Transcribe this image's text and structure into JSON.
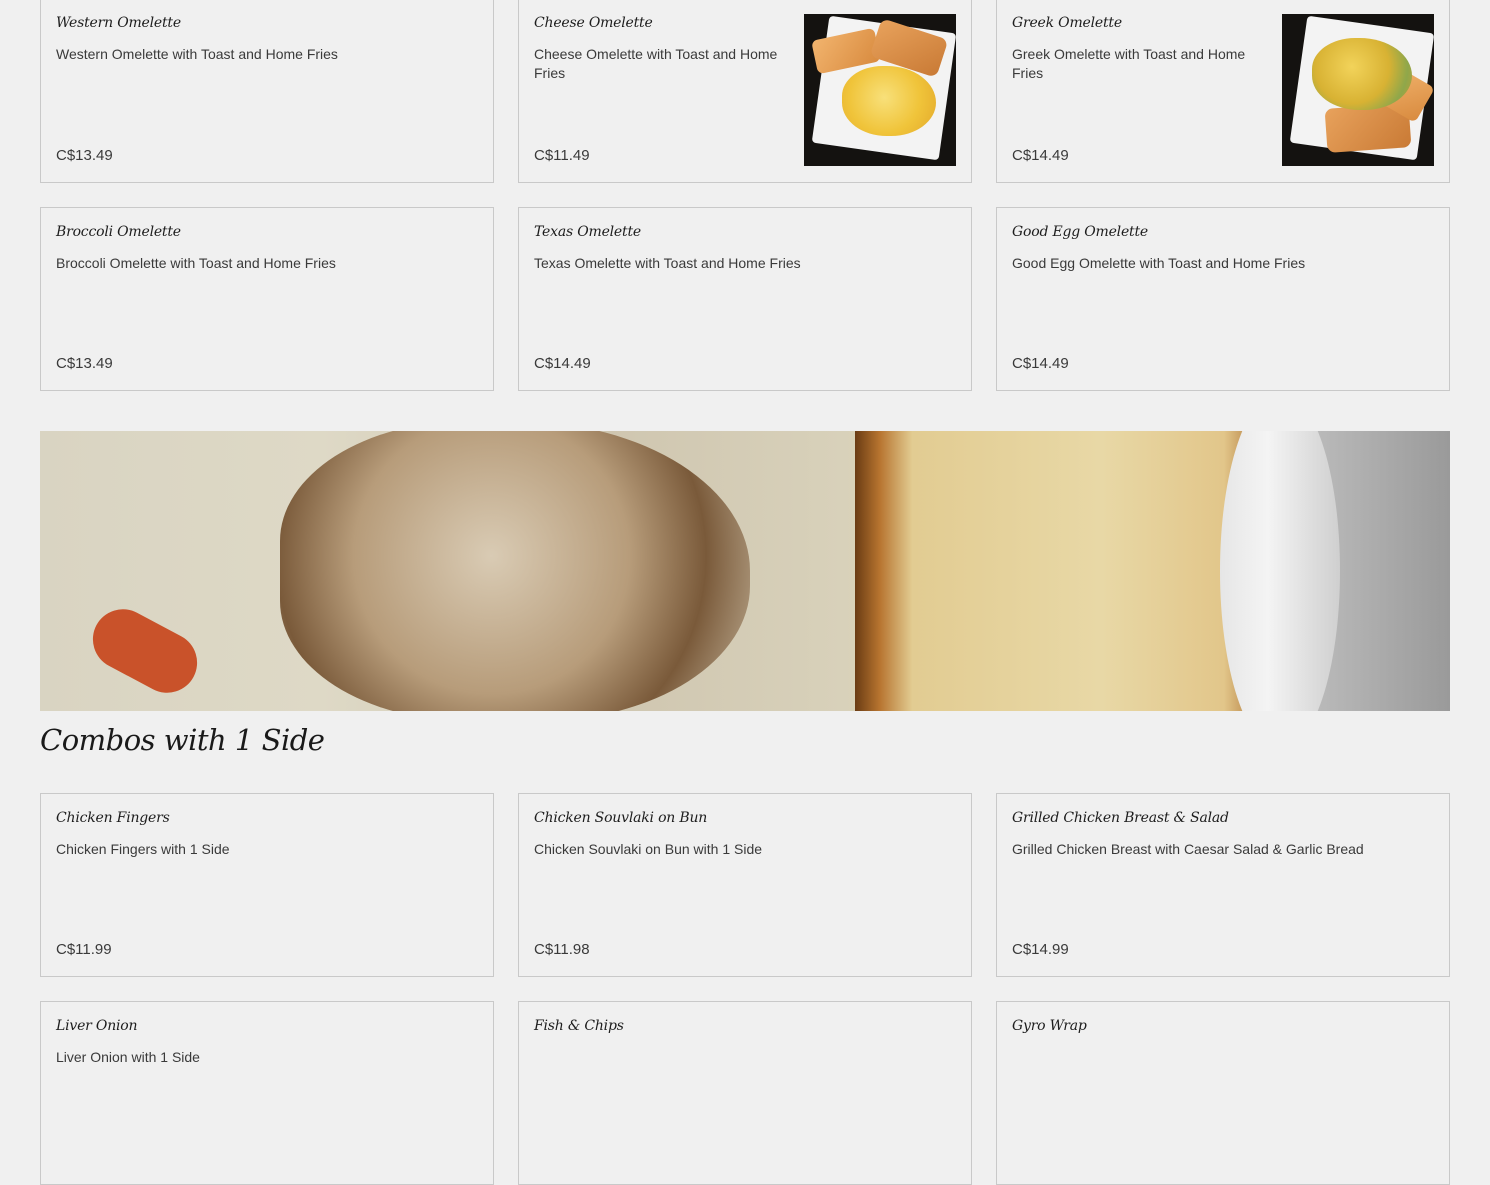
{
  "omelettes_row1": [
    {
      "name": "Western Omelette",
      "description": "Western Omelette with Toast and Home Fries",
      "price": "C$13.49",
      "has_image": false
    },
    {
      "name": "Cheese Omelette",
      "description": "Cheese Omelette with Toast and Home Fries",
      "price": "C$11.49",
      "has_image": true
    },
    {
      "name": "Greek Omelette",
      "description": "Greek Omelette with Toast and Home Fries",
      "price": "C$14.49",
      "has_image": true
    }
  ],
  "omelettes_row2": [
    {
      "name": "Broccoli Omelette",
      "description": "Broccoli Omelette with Toast and Home Fries",
      "price": "C$13.49"
    },
    {
      "name": "Texas Omelette",
      "description": "Texas Omelette with Toast and Home Fries",
      "price": "C$14.49"
    },
    {
      "name": "Good Egg Omelette",
      "description": "Good Egg Omelette with Toast and Home Fries",
      "price": "C$14.49"
    }
  ],
  "combos_section": {
    "title": "Combos with 1 Side"
  },
  "combos_row1": [
    {
      "name": "Chicken Fingers",
      "description": "Chicken Fingers with 1 Side",
      "price": "C$11.99"
    },
    {
      "name": "Chicken Souvlaki on Bun",
      "description": "Chicken Souvlaki on Bun with 1 Side",
      "price": "C$11.98"
    },
    {
      "name": "Grilled Chicken Breast & Salad",
      "description": "Grilled Chicken Breast with Caesar Salad & Garlic Bread",
      "price": "C$14.99"
    }
  ],
  "combos_row2": [
    {
      "name": "Liver Onion",
      "description": "Liver Onion with 1 Side"
    },
    {
      "name": "Fish & Chips",
      "description": ""
    },
    {
      "name": "Gyro Wrap",
      "description": ""
    }
  ]
}
